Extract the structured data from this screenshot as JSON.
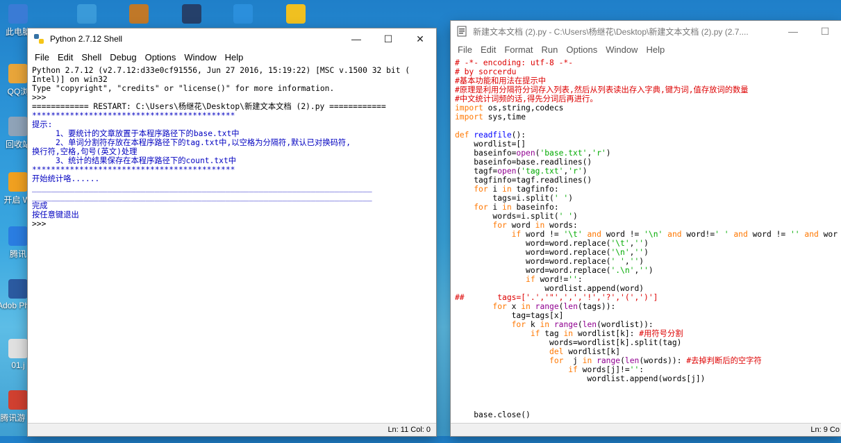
{
  "desktop": {
    "icons": [
      {
        "label": "此电脑",
        "color": "#3a7bd5"
      },
      {
        "label": "QQ浏",
        "color": "#e8a53a"
      },
      {
        "label": "回收站",
        "color": "#8fa3b8"
      },
      {
        "label": "开启 Wi",
        "color": "#f0a020"
      },
      {
        "label": "腾讯",
        "color": "#2a7de1"
      },
      {
        "label": "Adob Photo",
        "color": "#2b5aa0"
      },
      {
        "label": "01.j",
        "color": "#e0e0e0"
      },
      {
        "label": "腾讯游 台",
        "color": "#d04030"
      }
    ],
    "top_icons": [
      {
        "label": "",
        "color": "#3a9ad9"
      },
      {
        "label": "",
        "color": "#c07828"
      },
      {
        "label": "",
        "color": "#25406a"
      },
      {
        "label": "",
        "color": "#2b8fdc"
      },
      {
        "label": "",
        "color": "#f0c020"
      }
    ]
  },
  "shell": {
    "title": "Python 2.7.12 Shell",
    "menu": [
      "File",
      "Edit",
      "Shell",
      "Debug",
      "Options",
      "Window",
      "Help"
    ],
    "lines": [
      {
        "cls": "c-out",
        "text": "Python 2.7.12 (v2.7.12:d33e0cf91556, Jun 27 2016, 15:19:22) [MSC v.1500 32 bit ("
      },
      {
        "cls": "c-out",
        "text": "Intel)] on win32"
      },
      {
        "cls": "c-out",
        "text": "Type \"copyright\", \"credits\" or \"license()\" for more information."
      },
      {
        "cls": "c-out",
        "text": ">>> "
      },
      {
        "cls": "c-out",
        "text": "============ RESTART: C:\\Users\\杨继花\\Desktop\\新建文本文档 (2).py ============"
      },
      {
        "cls": "c-blue",
        "text": "*******************************************"
      },
      {
        "cls": "c-blue",
        "text": "提示:"
      },
      {
        "cls": "c-blue",
        "text": "     1、要统计的文章放置于本程序路径下的base.txt中"
      },
      {
        "cls": "c-blue",
        "text": "     2、单词分割符存放在本程序路径下的tag.txt中,以空格为分隔符,默认已对换码符,"
      },
      {
        "cls": "c-blue",
        "text": "换行符,空格,句号(英文)处理"
      },
      {
        "cls": "c-blue",
        "text": "     3、统计的结果保存在本程序路径下的count.txt中"
      },
      {
        "cls": "c-blue",
        "text": "*******************************************"
      },
      {
        "cls": "c-blue",
        "text": "开始统计咯......"
      },
      {
        "cls": "c-blue",
        "text": "________________________________________________________________________"
      },
      {
        "cls": "c-blue",
        "text": "________________________________________________________________________"
      },
      {
        "cls": "c-blue",
        "text": "完成"
      },
      {
        "cls": "c-blue",
        "text": "按任意键退出"
      },
      {
        "cls": "c-out",
        "text": ">>> "
      }
    ],
    "status": "Ln: 11   Col: 0"
  },
  "editor": {
    "title": "新建文本文档 (2).py - C:\\Users\\杨继花\\Desktop\\新建文本文档 (2).py (2.7....",
    "menu": [
      "File",
      "Edit",
      "Format",
      "Run",
      "Options",
      "Window",
      "Help"
    ],
    "status": "Ln: 9   Co",
    "code": [
      [
        {
          "c": "cm",
          "t": "# -*- encoding: utf-8 -*-"
        }
      ],
      [
        {
          "c": "cm",
          "t": "# by sorcerdu"
        }
      ],
      [
        {
          "c": "cm",
          "t": "#基本功能和用法在提示中"
        }
      ],
      [
        {
          "c": "cm",
          "t": "#原理是利用分隔符分词存入列表,然后从列表读出存入字典,键为词,值存放词的数量"
        }
      ],
      [
        {
          "c": "cm",
          "t": "#中文统计词频的话,得先分词后再进行。"
        }
      ],
      [
        {
          "c": "k",
          "t": "import"
        },
        {
          "c": "",
          "t": " os,string,codecs"
        }
      ],
      [
        {
          "c": "k",
          "t": "import"
        },
        {
          "c": "",
          "t": " sys,time"
        }
      ],
      [
        {
          "c": "",
          "t": ""
        }
      ],
      [
        {
          "c": "k",
          "t": "def"
        },
        {
          "c": "",
          "t": " "
        },
        {
          "c": "f",
          "t": "readfile"
        },
        {
          "c": "",
          "t": "():"
        }
      ],
      [
        {
          "c": "",
          "t": "    wordlist=[]"
        }
      ],
      [
        {
          "c": "",
          "t": "    baseinfo="
        },
        {
          "c": "b",
          "t": "open"
        },
        {
          "c": "",
          "t": "("
        },
        {
          "c": "s",
          "t": "'base.txt'"
        },
        {
          "c": "",
          "t": ","
        },
        {
          "c": "s",
          "t": "'r'"
        },
        {
          "c": "",
          "t": ")"
        }
      ],
      [
        {
          "c": "",
          "t": "    baseinfo=base.readlines()"
        }
      ],
      [
        {
          "c": "",
          "t": "    tagf="
        },
        {
          "c": "b",
          "t": "open"
        },
        {
          "c": "",
          "t": "("
        },
        {
          "c": "s",
          "t": "'tag.txt'"
        },
        {
          "c": "",
          "t": ","
        },
        {
          "c": "s",
          "t": "'r'"
        },
        {
          "c": "",
          "t": ")"
        }
      ],
      [
        {
          "c": "",
          "t": "    tagfinfo=tagf.readlines()"
        }
      ],
      [
        {
          "c": "",
          "t": "    "
        },
        {
          "c": "k",
          "t": "for"
        },
        {
          "c": "",
          "t": " i "
        },
        {
          "c": "k",
          "t": "in"
        },
        {
          "c": "",
          "t": " tagfinfo:"
        }
      ],
      [
        {
          "c": "",
          "t": "        tags=i.split("
        },
        {
          "c": "s",
          "t": "' '"
        },
        {
          "c": "",
          "t": ")"
        }
      ],
      [
        {
          "c": "",
          "t": "    "
        },
        {
          "c": "k",
          "t": "for"
        },
        {
          "c": "",
          "t": " i "
        },
        {
          "c": "k",
          "t": "in"
        },
        {
          "c": "",
          "t": " baseinfo:"
        }
      ],
      [
        {
          "c": "",
          "t": "        words=i.split("
        },
        {
          "c": "s",
          "t": "' '"
        },
        {
          "c": "",
          "t": ")"
        }
      ],
      [
        {
          "c": "",
          "t": "        "
        },
        {
          "c": "k",
          "t": "for"
        },
        {
          "c": "",
          "t": " word "
        },
        {
          "c": "k",
          "t": "in"
        },
        {
          "c": "",
          "t": " words:"
        }
      ],
      [
        {
          "c": "",
          "t": "            "
        },
        {
          "c": "k",
          "t": "if"
        },
        {
          "c": "",
          "t": " word != "
        },
        {
          "c": "s",
          "t": "'\\t'"
        },
        {
          "c": "",
          "t": " "
        },
        {
          "c": "k",
          "t": "and"
        },
        {
          "c": "",
          "t": " word != "
        },
        {
          "c": "s",
          "t": "'\\n'"
        },
        {
          "c": "",
          "t": " "
        },
        {
          "c": "k",
          "t": "and"
        },
        {
          "c": "",
          "t": " word!="
        },
        {
          "c": "s",
          "t": "' '"
        },
        {
          "c": "",
          "t": " "
        },
        {
          "c": "k",
          "t": "and"
        },
        {
          "c": "",
          "t": " word != "
        },
        {
          "c": "s",
          "t": "''"
        },
        {
          "c": "",
          "t": " "
        },
        {
          "c": "k",
          "t": "and"
        },
        {
          "c": "",
          "t": " wor"
        }
      ],
      [
        {
          "c": "",
          "t": "               word=word.replace("
        },
        {
          "c": "s",
          "t": "'\\t'"
        },
        {
          "c": "",
          "t": ","
        },
        {
          "c": "s",
          "t": "''"
        },
        {
          "c": "",
          "t": ")"
        }
      ],
      [
        {
          "c": "",
          "t": "               word=word.replace("
        },
        {
          "c": "s",
          "t": "'\\n'"
        },
        {
          "c": "",
          "t": ","
        },
        {
          "c": "s",
          "t": "''"
        },
        {
          "c": "",
          "t": ")"
        }
      ],
      [
        {
          "c": "",
          "t": "               word=word.replace("
        },
        {
          "c": "s",
          "t": "' '"
        },
        {
          "c": "",
          "t": ","
        },
        {
          "c": "s",
          "t": "''"
        },
        {
          "c": "",
          "t": ")"
        }
      ],
      [
        {
          "c": "",
          "t": "               word=word.replace("
        },
        {
          "c": "s",
          "t": "'.\\n'"
        },
        {
          "c": "",
          "t": ","
        },
        {
          "c": "s",
          "t": "''"
        },
        {
          "c": "",
          "t": ")"
        }
      ],
      [
        {
          "c": "",
          "t": "               "
        },
        {
          "c": "k",
          "t": "if"
        },
        {
          "c": "",
          "t": " word!="
        },
        {
          "c": "s",
          "t": "''"
        },
        {
          "c": "",
          "t": ":"
        }
      ],
      [
        {
          "c": "",
          "t": "                   wordlist.append(word)"
        }
      ],
      [
        {
          "c": "cm",
          "t": "##       tags=['.','\"',',','!','?','(',')']"
        }
      ],
      [
        {
          "c": "",
          "t": "        "
        },
        {
          "c": "k",
          "t": "for"
        },
        {
          "c": "",
          "t": " x "
        },
        {
          "c": "k",
          "t": "in"
        },
        {
          "c": "",
          "t": " "
        },
        {
          "c": "b",
          "t": "range"
        },
        {
          "c": "",
          "t": "("
        },
        {
          "c": "b",
          "t": "len"
        },
        {
          "c": "",
          "t": "(tags)):"
        }
      ],
      [
        {
          "c": "",
          "t": "            tag=tags[x]"
        }
      ],
      [
        {
          "c": "",
          "t": "            "
        },
        {
          "c": "k",
          "t": "for"
        },
        {
          "c": "",
          "t": " k "
        },
        {
          "c": "k",
          "t": "in"
        },
        {
          "c": "",
          "t": " "
        },
        {
          "c": "b",
          "t": "range"
        },
        {
          "c": "",
          "t": "("
        },
        {
          "c": "b",
          "t": "len"
        },
        {
          "c": "",
          "t": "(wordlist)):"
        }
      ],
      [
        {
          "c": "",
          "t": "                "
        },
        {
          "c": "k",
          "t": "if"
        },
        {
          "c": "",
          "t": " tag "
        },
        {
          "c": "k",
          "t": "in"
        },
        {
          "c": "",
          "t": " wordlist[k]: "
        },
        {
          "c": "cm",
          "t": "#用符号分割"
        }
      ],
      [
        {
          "c": "",
          "t": "                    words=wordlist[k].split(tag)"
        }
      ],
      [
        {
          "c": "",
          "t": "                    "
        },
        {
          "c": "k",
          "t": "del"
        },
        {
          "c": "",
          "t": " wordlist[k]"
        }
      ],
      [
        {
          "c": "",
          "t": "                    "
        },
        {
          "c": "k",
          "t": "for"
        },
        {
          "c": "",
          "t": "  j "
        },
        {
          "c": "k",
          "t": "in"
        },
        {
          "c": "",
          "t": " "
        },
        {
          "c": "b",
          "t": "range"
        },
        {
          "c": "",
          "t": "("
        },
        {
          "c": "b",
          "t": "len"
        },
        {
          "c": "",
          "t": "(words)): "
        },
        {
          "c": "cm",
          "t": "#去掉判断后的空字符"
        }
      ],
      [
        {
          "c": "",
          "t": "                        "
        },
        {
          "c": "k",
          "t": "if"
        },
        {
          "c": "",
          "t": " words[j]!="
        },
        {
          "c": "s",
          "t": "''"
        },
        {
          "c": "",
          "t": ":"
        }
      ],
      [
        {
          "c": "",
          "t": "                            wordlist.append(words[j])"
        }
      ],
      [
        {
          "c": "",
          "t": ""
        }
      ],
      [
        {
          "c": "",
          "t": ""
        }
      ],
      [
        {
          "c": "",
          "t": ""
        }
      ],
      [
        {
          "c": "",
          "t": "    base.close()"
        }
      ]
    ]
  }
}
